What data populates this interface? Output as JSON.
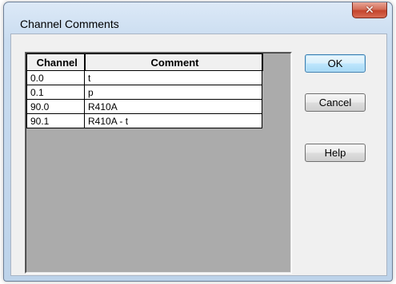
{
  "window": {
    "title": "Channel Comments",
    "close_glyph": "✕"
  },
  "table": {
    "headers": [
      "Channel",
      "Comment"
    ],
    "rows": [
      {
        "channel": "0.0",
        "comment": "t"
      },
      {
        "channel": "0.1",
        "comment": "p"
      },
      {
        "channel": "90.0",
        "comment": "R410A"
      },
      {
        "channel": "90.1",
        "comment": "R410A - t"
      }
    ]
  },
  "buttons": {
    "ok": "OK",
    "cancel": "Cancel",
    "help": "Help"
  }
}
